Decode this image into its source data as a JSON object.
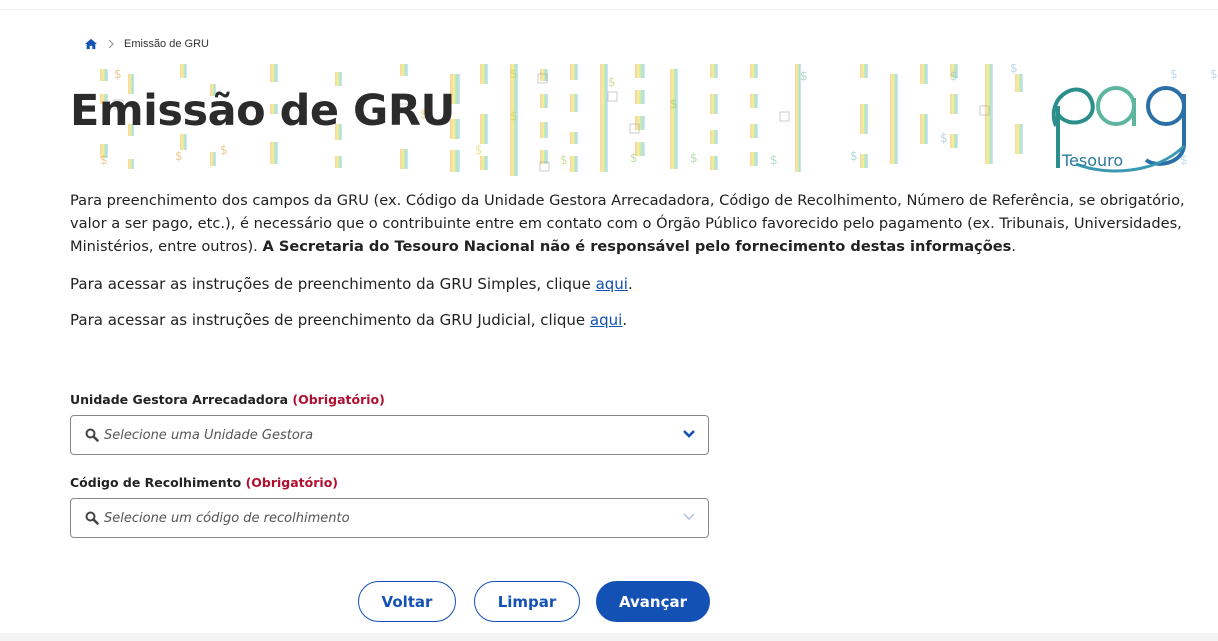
{
  "breadcrumb": {
    "home_icon": "home-icon",
    "separator_icon": "chevron-right-icon",
    "current": "Emissão de GRU"
  },
  "banner": {
    "title": "Emissão de GRU",
    "logo_text": "pag",
    "logo_subtext": "Tesouro"
  },
  "intro": {
    "text": "Para preenchimento dos campos da GRU (ex. Código da Unidade Gestora Arrecadadora, Código de Recolhimento, Número de Referência, se obrigatório, valor a ser pago, etc.), é necessário que o contribuinte entre em contato com o Órgão Público favorecido pelo pagamento (ex. Tribunais, Universidades, Ministérios, entre outros). ",
    "bold": "A Secretaria do Tesouro Nacional não é responsável pelo fornecimento destas informações",
    "end": "."
  },
  "links": {
    "simples_text": "Para acessar as instruções de preenchimento da GRU Simples, clique ",
    "simples_link": "aqui",
    "simples_end": ".",
    "judicial_text": "Para acessar as instruções de preenchimento da GRU Judicial, clique ",
    "judicial_link": "aqui",
    "judicial_end": "."
  },
  "form": {
    "ug": {
      "label": "Unidade Gestora Arrecadadora",
      "required": "(Obrigatório)",
      "placeholder": "Selecione uma Unidade Gestora"
    },
    "codigo": {
      "label": "Código de Recolhimento",
      "required": "(Obrigatório)",
      "placeholder": "Selecione um código de recolhimento"
    }
  },
  "buttons": {
    "back": "Voltar",
    "clear": "Limpar",
    "next": "Avançar"
  },
  "colors": {
    "primary": "#1351b4",
    "required": "#b01030"
  }
}
